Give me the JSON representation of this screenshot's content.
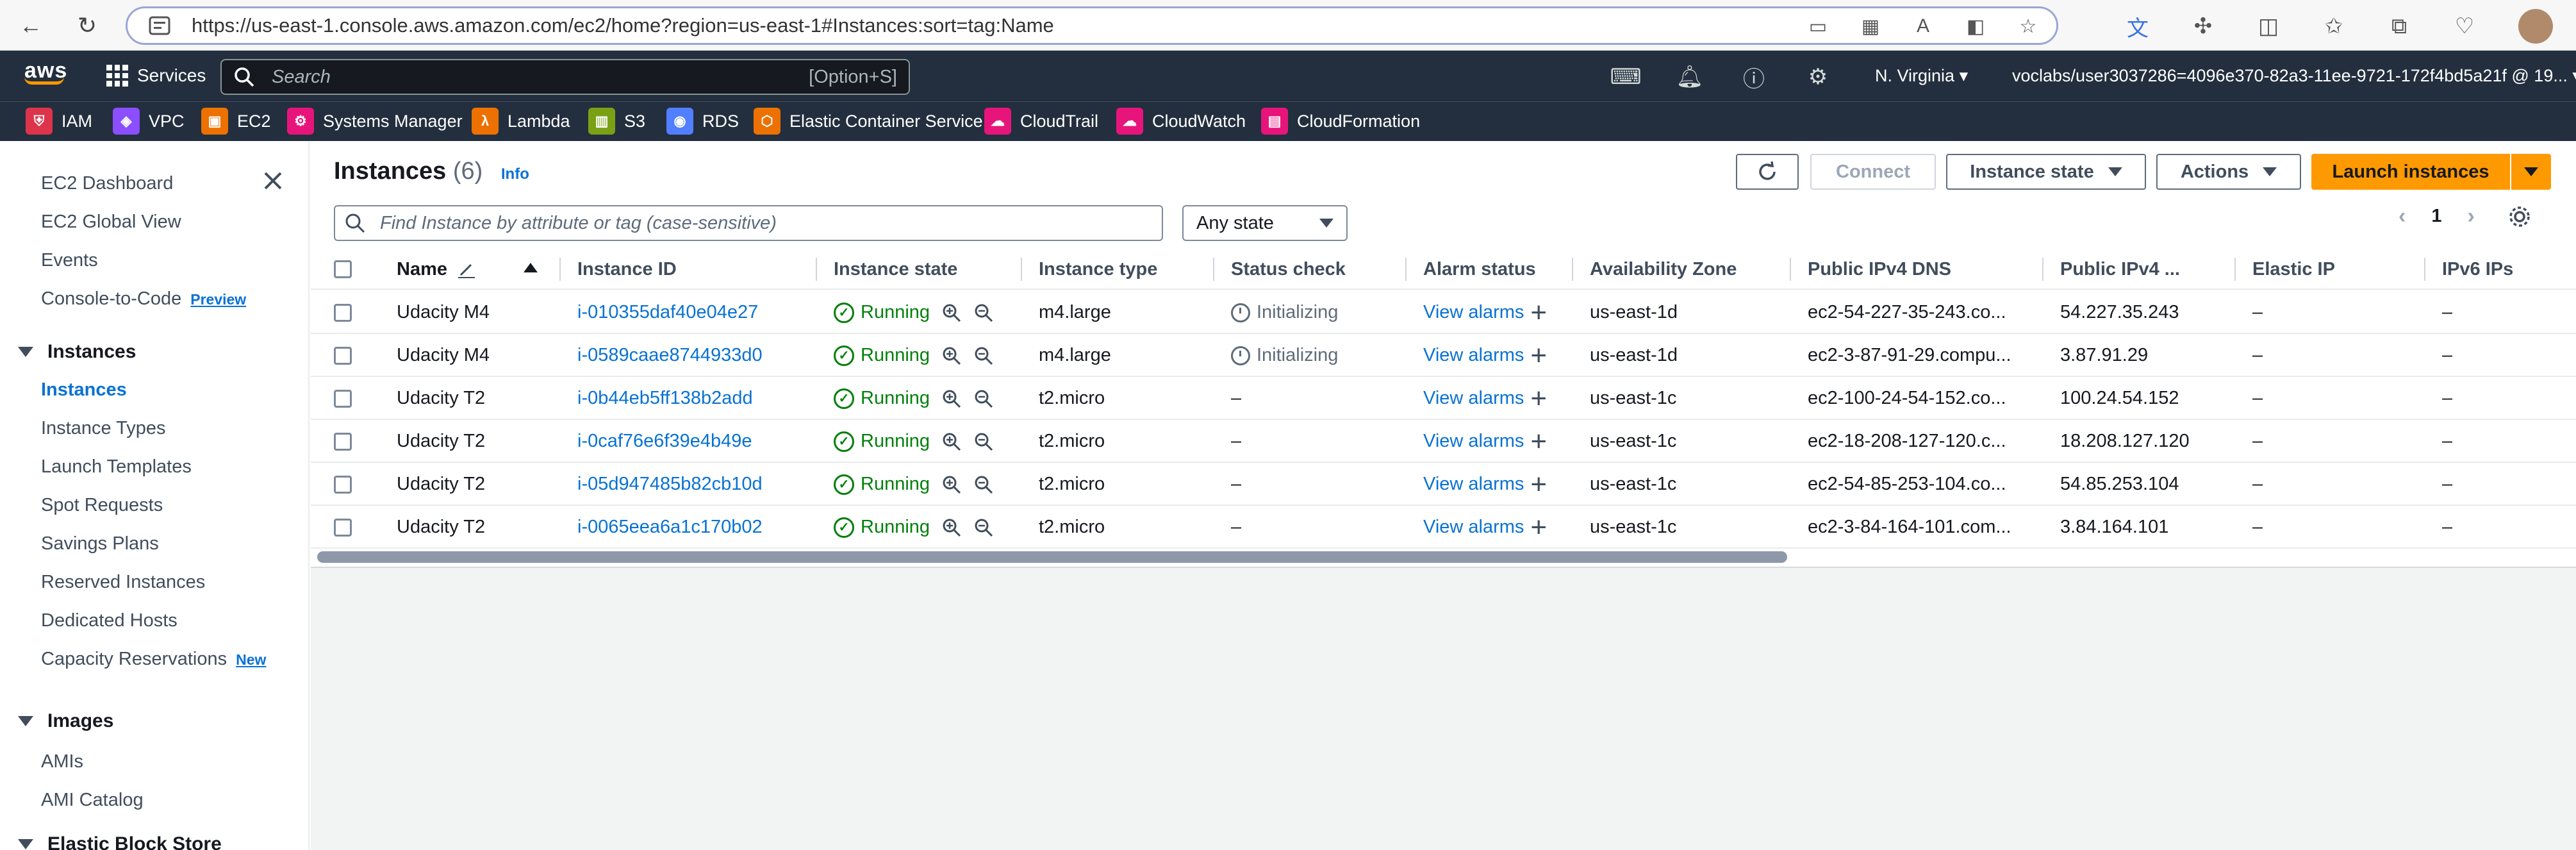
{
  "browser": {
    "url": "https://us-east-1.console.aws.amazon.com/ec2/home?region=us-east-1#Instances:sort=tag:Name"
  },
  "aws_nav": {
    "logo": "aws",
    "services_label": "Services",
    "search_placeholder": "Search",
    "search_shortcut": "[Option+S]",
    "region": "N. Virginia",
    "account": "voclabs/user3037286=4096e370-82a3-11ee-9721-172f4bd5a21f @ 19..."
  },
  "favorites": [
    {
      "label": "IAM",
      "color": "#dd344c"
    },
    {
      "label": "VPC",
      "color": "#8c4fff"
    },
    {
      "label": "EC2",
      "color": "#ed7100"
    },
    {
      "label": "Systems Manager",
      "color": "#e7157b"
    },
    {
      "label": "Lambda",
      "color": "#ed7100"
    },
    {
      "label": "S3",
      "color": "#7aa116"
    },
    {
      "label": "RDS",
      "color": "#527fff"
    },
    {
      "label": "Elastic Container Service",
      "color": "#ed7100"
    },
    {
      "label": "CloudTrail",
      "color": "#e7157b"
    },
    {
      "label": "CloudWatch",
      "color": "#e7157b"
    },
    {
      "label": "CloudFormation",
      "color": "#e7157b"
    }
  ],
  "sidebar": {
    "items": [
      {
        "label": "EC2 Dashboard"
      },
      {
        "label": "EC2 Global View"
      },
      {
        "label": "Events"
      },
      {
        "label": "Console-to-Code",
        "badge": "Preview"
      }
    ],
    "sections": [
      {
        "title": "Instances",
        "items": [
          "Instances",
          "Instance Types",
          "Launch Templates",
          "Spot Requests",
          "Savings Plans",
          "Reserved Instances",
          "Dedicated Hosts",
          "Capacity Reservations"
        ],
        "badge": "New"
      },
      {
        "title": "Images",
        "items": [
          "AMIs",
          "AMI Catalog"
        ]
      },
      {
        "title": "Elastic Block Store",
        "items": []
      }
    ],
    "active": "Instances"
  },
  "main": {
    "title": "Instances",
    "count": "(6)",
    "info": "Info",
    "connect": "Connect",
    "instance_state": "Instance state",
    "actions": "Actions",
    "launch": "Launch instances",
    "filter_placeholder": "Find Instance by attribute or tag (case-sensitive)",
    "state_filter": "Any state",
    "page": "1",
    "columns": [
      "Name",
      "Instance ID",
      "Instance state",
      "Instance type",
      "Status check",
      "Alarm status",
      "Availability Zone",
      "Public IPv4 DNS",
      "Public IPv4 ...",
      "Elastic IP",
      "IPv6 IPs"
    ],
    "rows": [
      {
        "name": "Udacity M4",
        "id": "i-010355daf40e04e27",
        "state": "Running",
        "type": "m4.large",
        "status": "Initializing",
        "alarm": "View alarms",
        "az": "us-east-1d",
        "dns": "ec2-54-227-35-243.co...",
        "ip": "54.227.35.243",
        "eip": "–",
        "ipv6": "–"
      },
      {
        "name": "Udacity M4",
        "id": "i-0589caae8744933d0",
        "state": "Running",
        "type": "m4.large",
        "status": "Initializing",
        "alarm": "View alarms",
        "az": "us-east-1d",
        "dns": "ec2-3-87-91-29.compu...",
        "ip": "3.87.91.29",
        "eip": "–",
        "ipv6": "–"
      },
      {
        "name": "Udacity T2",
        "id": "i-0b44eb5ff138b2add",
        "state": "Running",
        "type": "t2.micro",
        "status": "–",
        "alarm": "View alarms",
        "az": "us-east-1c",
        "dns": "ec2-100-24-54-152.co...",
        "ip": "100.24.54.152",
        "eip": "–",
        "ipv6": "–"
      },
      {
        "name": "Udacity T2",
        "id": "i-0caf76e6f39e4b49e",
        "state": "Running",
        "type": "t2.micro",
        "status": "–",
        "alarm": "View alarms",
        "az": "us-east-1c",
        "dns": "ec2-18-208-127-120.c...",
        "ip": "18.208.127.120",
        "eip": "–",
        "ipv6": "–"
      },
      {
        "name": "Udacity T2",
        "id": "i-05d947485b82cb10d",
        "state": "Running",
        "type": "t2.micro",
        "status": "–",
        "alarm": "View alarms",
        "az": "us-east-1c",
        "dns": "ec2-54-85-253-104.co...",
        "ip": "54.85.253.104",
        "eip": "–",
        "ipv6": "–"
      },
      {
        "name": "Udacity T2",
        "id": "i-0065eea6a1c170b02",
        "state": "Running",
        "type": "t2.micro",
        "status": "–",
        "alarm": "View alarms",
        "az": "us-east-1c",
        "dns": "ec2-3-84-164-101.com...",
        "ip": "3.84.164.101",
        "eip": "–",
        "ipv6": "–"
      }
    ]
  }
}
